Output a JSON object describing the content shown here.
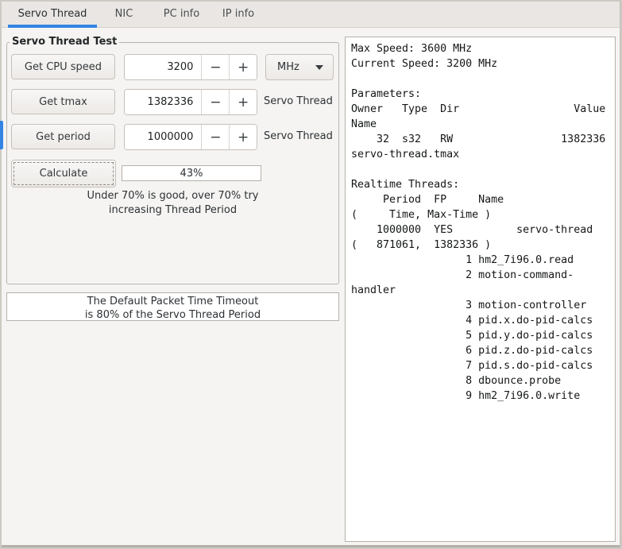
{
  "colors": {
    "accent": "#3584e4"
  },
  "tabs": [
    {
      "label": "Servo Thread",
      "active": true
    },
    {
      "label": "NIC",
      "active": false
    },
    {
      "label": "PC info",
      "active": false
    },
    {
      "label": "IP info",
      "active": false
    }
  ],
  "frame": {
    "title": "Servo Thread Test",
    "rows": [
      {
        "button": "Get CPU speed",
        "value": "3200",
        "unit": "MHz"
      },
      {
        "button": "Get tmax",
        "value": "1382336",
        "label": "Servo Thread"
      },
      {
        "button": "Get period",
        "value": "1000000",
        "label": "Servo Thread"
      }
    ],
    "calculate_button": "Calculate",
    "progress_text": "43%",
    "hint_line1": "Under 70% is good, over 70% try",
    "hint_line2": "increasing Thread Period"
  },
  "icons": {
    "minus": "−",
    "plus": "+"
  },
  "info_box": {
    "line1": "The Default Packet Time Timeout",
    "line2": "is 80% of the Servo Thread Period"
  },
  "output": {
    "text": "Max Speed: 3600 MHz\nCurrent Speed: 3200 MHz\n\nParameters:\nOwner   Type  Dir                  Value\nName\n    32  s32   RW                 1382336\nservo-thread.tmax\n\nRealtime Threads:\n     Period  FP     Name\n(     Time, Max-Time )\n    1000000  YES          servo-thread\n(   871061,  1382336 )\n                  1 hm2_7i96.0.read\n                  2 motion-command-\nhandler\n                  3 motion-controller\n                  4 pid.x.do-pid-calcs\n                  5 pid.y.do-pid-calcs\n                  6 pid.z.do-pid-calcs\n                  7 pid.s.do-pid-calcs\n                  8 dbounce.probe\n                  9 hm2_7i96.0.write"
  }
}
